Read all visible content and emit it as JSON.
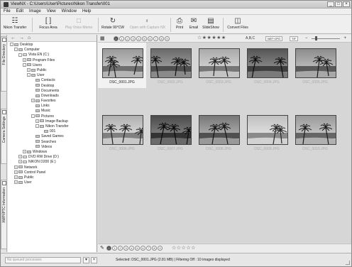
{
  "window": {
    "title": "ViewNX - C:\\Users\\User\\Pictures\\Nikon Transfer\\001",
    "controls": [
      "_",
      "□",
      "×"
    ]
  },
  "menubar": [
    "File",
    "Edit",
    "Image",
    "View",
    "Window",
    "Help"
  ],
  "toolbar": {
    "nikon_transfer": "Nikon Transfer",
    "focus_area": "Focus Area",
    "play_voice_memo": "Play Voice Memo",
    "rotate": "Rotate 90°CW",
    "open_capture_nx": "Open with Capture NX",
    "print": "Print",
    "email": "Email",
    "slideshow": "SlideShow",
    "convert_files": "Convert Files"
  },
  "left_tabs": [
    "File Directory",
    "Camera Settings",
    "XMP/IPTC Information"
  ],
  "left_toolbar": [
    "←",
    "→",
    "⌂"
  ],
  "tree": [
    {
      "label": "Desktop",
      "depth": 0,
      "exp": "-"
    },
    {
      "label": "Computer",
      "depth": 1,
      "exp": "-"
    },
    {
      "label": "Vista EN (C:)",
      "depth": 2,
      "exp": "-",
      "drive": true
    },
    {
      "label": "Program Files",
      "depth": 3,
      "exp": "+"
    },
    {
      "label": "Users",
      "depth": 3,
      "exp": "-"
    },
    {
      "label": "Public",
      "depth": 4,
      "exp": "+"
    },
    {
      "label": "User",
      "depth": 4,
      "exp": "-"
    },
    {
      "label": "Contacts",
      "depth": 5,
      "exp": ""
    },
    {
      "label": "Desktop",
      "depth": 5,
      "exp": ""
    },
    {
      "label": "Documents",
      "depth": 5,
      "exp": ""
    },
    {
      "label": "Downloads",
      "depth": 5,
      "exp": ""
    },
    {
      "label": "Favorites",
      "depth": 5,
      "exp": "+"
    },
    {
      "label": "Links",
      "depth": 5,
      "exp": ""
    },
    {
      "label": "Music",
      "depth": 5,
      "exp": ""
    },
    {
      "label": "Pictures",
      "depth": 5,
      "exp": "-"
    },
    {
      "label": "Image Backup",
      "depth": 6,
      "exp": "+"
    },
    {
      "label": "Nikon Transfer",
      "depth": 6,
      "exp": "-"
    },
    {
      "label": "001",
      "depth": 7,
      "exp": ""
    },
    {
      "label": "Saved Games",
      "depth": 5,
      "exp": ""
    },
    {
      "label": "Searches",
      "depth": 5,
      "exp": ""
    },
    {
      "label": "Videos",
      "depth": 5,
      "exp": ""
    },
    {
      "label": "Windows",
      "depth": 3,
      "exp": "+"
    },
    {
      "label": "DVD RW Drive (D:)",
      "depth": 2,
      "exp": "+",
      "drive": true
    },
    {
      "label": "NIKON D200 (E:)",
      "depth": 2,
      "exp": "+",
      "drive": true
    },
    {
      "label": "Network",
      "depth": 1,
      "exp": "+"
    },
    {
      "label": "Control Panel",
      "depth": 1,
      "exp": "+"
    },
    {
      "label": "Public",
      "depth": 1,
      "exp": "+"
    },
    {
      "label": "User",
      "depth": 1,
      "exp": "+"
    }
  ],
  "content_toolbar": {
    "label_buttons": [
      "0",
      "1",
      "2",
      "3",
      "4",
      "5",
      "6",
      "7",
      "8",
      "9"
    ],
    "stars": "☆★★★★★",
    "sort": "A,B,C",
    "format1": "NEF+JPG",
    "format2": "TIF"
  },
  "thumbnails": [
    {
      "name": "DSC_0001.JPG",
      "selected": true,
      "scene": 0
    },
    {
      "name": "DSC_0002.JPG",
      "selected": false,
      "scene": 1
    },
    {
      "name": "DSC_0003.JPG",
      "selected": false,
      "scene": 2
    },
    {
      "name": "DSC_0004.JPG",
      "selected": false,
      "scene": 3
    },
    {
      "name": "DSC_0005.JPG",
      "selected": false,
      "scene": 4
    },
    {
      "name": "DSC_0006.JPG",
      "selected": false,
      "scene": 5
    },
    {
      "name": "DSC_0007.JPG",
      "selected": false,
      "scene": 6
    },
    {
      "name": "DSC_0008.JPG",
      "selected": false,
      "scene": 7
    },
    {
      "name": "DSC_0009.JPG",
      "selected": false,
      "scene": 8
    },
    {
      "name": "DSC_0010.JPG",
      "selected": false,
      "scene": 9
    }
  ],
  "bottom_bar": {
    "label_buttons": [
      "0",
      "1",
      "2",
      "3",
      "4",
      "5",
      "6",
      "7",
      "8",
      "9"
    ],
    "stars": "☆☆☆☆☆"
  },
  "status": {
    "queue": "No queued processes",
    "text": "Selected: DSC_0001.JPG (2.81 MB) | Filtering Off : 10 images displayed"
  },
  "colors": {
    "thumb_area_bg": "#d6d6d6",
    "selected_card_bg": "#f2f2f2"
  }
}
